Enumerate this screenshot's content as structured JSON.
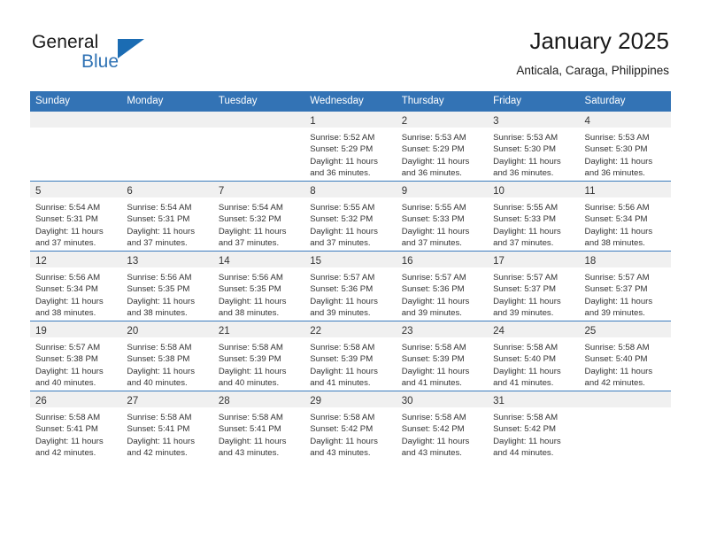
{
  "brand": {
    "name_part1": "General",
    "name_part2": "Blue",
    "accent_color": "#2f72b4"
  },
  "header": {
    "title": "January 2025",
    "subtitle": "Anticala, Caraga, Philippines"
  },
  "calendar": {
    "header_color": "#3373b5",
    "weekday_headers": [
      "Sunday",
      "Monday",
      "Tuesday",
      "Wednesday",
      "Thursday",
      "Friday",
      "Saturday"
    ],
    "weeks": [
      [
        {
          "day": "",
          "sunrise": "",
          "sunset": "",
          "daylight_1": "",
          "daylight_2": ""
        },
        {
          "day": "",
          "sunrise": "",
          "sunset": "",
          "daylight_1": "",
          "daylight_2": ""
        },
        {
          "day": "",
          "sunrise": "",
          "sunset": "",
          "daylight_1": "",
          "daylight_2": ""
        },
        {
          "day": "1",
          "sunrise": "Sunrise: 5:52 AM",
          "sunset": "Sunset: 5:29 PM",
          "daylight_1": "Daylight: 11 hours",
          "daylight_2": "and 36 minutes."
        },
        {
          "day": "2",
          "sunrise": "Sunrise: 5:53 AM",
          "sunset": "Sunset: 5:29 PM",
          "daylight_1": "Daylight: 11 hours",
          "daylight_2": "and 36 minutes."
        },
        {
          "day": "3",
          "sunrise": "Sunrise: 5:53 AM",
          "sunset": "Sunset: 5:30 PM",
          "daylight_1": "Daylight: 11 hours",
          "daylight_2": "and 36 minutes."
        },
        {
          "day": "4",
          "sunrise": "Sunrise: 5:53 AM",
          "sunset": "Sunset: 5:30 PM",
          "daylight_1": "Daylight: 11 hours",
          "daylight_2": "and 36 minutes."
        }
      ],
      [
        {
          "day": "5",
          "sunrise": "Sunrise: 5:54 AM",
          "sunset": "Sunset: 5:31 PM",
          "daylight_1": "Daylight: 11 hours",
          "daylight_2": "and 37 minutes."
        },
        {
          "day": "6",
          "sunrise": "Sunrise: 5:54 AM",
          "sunset": "Sunset: 5:31 PM",
          "daylight_1": "Daylight: 11 hours",
          "daylight_2": "and 37 minutes."
        },
        {
          "day": "7",
          "sunrise": "Sunrise: 5:54 AM",
          "sunset": "Sunset: 5:32 PM",
          "daylight_1": "Daylight: 11 hours",
          "daylight_2": "and 37 minutes."
        },
        {
          "day": "8",
          "sunrise": "Sunrise: 5:55 AM",
          "sunset": "Sunset: 5:32 PM",
          "daylight_1": "Daylight: 11 hours",
          "daylight_2": "and 37 minutes."
        },
        {
          "day": "9",
          "sunrise": "Sunrise: 5:55 AM",
          "sunset": "Sunset: 5:33 PM",
          "daylight_1": "Daylight: 11 hours",
          "daylight_2": "and 37 minutes."
        },
        {
          "day": "10",
          "sunrise": "Sunrise: 5:55 AM",
          "sunset": "Sunset: 5:33 PM",
          "daylight_1": "Daylight: 11 hours",
          "daylight_2": "and 37 minutes."
        },
        {
          "day": "11",
          "sunrise": "Sunrise: 5:56 AM",
          "sunset": "Sunset: 5:34 PM",
          "daylight_1": "Daylight: 11 hours",
          "daylight_2": "and 38 minutes."
        }
      ],
      [
        {
          "day": "12",
          "sunrise": "Sunrise: 5:56 AM",
          "sunset": "Sunset: 5:34 PM",
          "daylight_1": "Daylight: 11 hours",
          "daylight_2": "and 38 minutes."
        },
        {
          "day": "13",
          "sunrise": "Sunrise: 5:56 AM",
          "sunset": "Sunset: 5:35 PM",
          "daylight_1": "Daylight: 11 hours",
          "daylight_2": "and 38 minutes."
        },
        {
          "day": "14",
          "sunrise": "Sunrise: 5:56 AM",
          "sunset": "Sunset: 5:35 PM",
          "daylight_1": "Daylight: 11 hours",
          "daylight_2": "and 38 minutes."
        },
        {
          "day": "15",
          "sunrise": "Sunrise: 5:57 AM",
          "sunset": "Sunset: 5:36 PM",
          "daylight_1": "Daylight: 11 hours",
          "daylight_2": "and 39 minutes."
        },
        {
          "day": "16",
          "sunrise": "Sunrise: 5:57 AM",
          "sunset": "Sunset: 5:36 PM",
          "daylight_1": "Daylight: 11 hours",
          "daylight_2": "and 39 minutes."
        },
        {
          "day": "17",
          "sunrise": "Sunrise: 5:57 AM",
          "sunset": "Sunset: 5:37 PM",
          "daylight_1": "Daylight: 11 hours",
          "daylight_2": "and 39 minutes."
        },
        {
          "day": "18",
          "sunrise": "Sunrise: 5:57 AM",
          "sunset": "Sunset: 5:37 PM",
          "daylight_1": "Daylight: 11 hours",
          "daylight_2": "and 39 minutes."
        }
      ],
      [
        {
          "day": "19",
          "sunrise": "Sunrise: 5:57 AM",
          "sunset": "Sunset: 5:38 PM",
          "daylight_1": "Daylight: 11 hours",
          "daylight_2": "and 40 minutes."
        },
        {
          "day": "20",
          "sunrise": "Sunrise: 5:58 AM",
          "sunset": "Sunset: 5:38 PM",
          "daylight_1": "Daylight: 11 hours",
          "daylight_2": "and 40 minutes."
        },
        {
          "day": "21",
          "sunrise": "Sunrise: 5:58 AM",
          "sunset": "Sunset: 5:39 PM",
          "daylight_1": "Daylight: 11 hours",
          "daylight_2": "and 40 minutes."
        },
        {
          "day": "22",
          "sunrise": "Sunrise: 5:58 AM",
          "sunset": "Sunset: 5:39 PM",
          "daylight_1": "Daylight: 11 hours",
          "daylight_2": "and 41 minutes."
        },
        {
          "day": "23",
          "sunrise": "Sunrise: 5:58 AM",
          "sunset": "Sunset: 5:39 PM",
          "daylight_1": "Daylight: 11 hours",
          "daylight_2": "and 41 minutes."
        },
        {
          "day": "24",
          "sunrise": "Sunrise: 5:58 AM",
          "sunset": "Sunset: 5:40 PM",
          "daylight_1": "Daylight: 11 hours",
          "daylight_2": "and 41 minutes."
        },
        {
          "day": "25",
          "sunrise": "Sunrise: 5:58 AM",
          "sunset": "Sunset: 5:40 PM",
          "daylight_1": "Daylight: 11 hours",
          "daylight_2": "and 42 minutes."
        }
      ],
      [
        {
          "day": "26",
          "sunrise": "Sunrise: 5:58 AM",
          "sunset": "Sunset: 5:41 PM",
          "daylight_1": "Daylight: 11 hours",
          "daylight_2": "and 42 minutes."
        },
        {
          "day": "27",
          "sunrise": "Sunrise: 5:58 AM",
          "sunset": "Sunset: 5:41 PM",
          "daylight_1": "Daylight: 11 hours",
          "daylight_2": "and 42 minutes."
        },
        {
          "day": "28",
          "sunrise": "Sunrise: 5:58 AM",
          "sunset": "Sunset: 5:41 PM",
          "daylight_1": "Daylight: 11 hours",
          "daylight_2": "and 43 minutes."
        },
        {
          "day": "29",
          "sunrise": "Sunrise: 5:58 AM",
          "sunset": "Sunset: 5:42 PM",
          "daylight_1": "Daylight: 11 hours",
          "daylight_2": "and 43 minutes."
        },
        {
          "day": "30",
          "sunrise": "Sunrise: 5:58 AM",
          "sunset": "Sunset: 5:42 PM",
          "daylight_1": "Daylight: 11 hours",
          "daylight_2": "and 43 minutes."
        },
        {
          "day": "31",
          "sunrise": "Sunrise: 5:58 AM",
          "sunset": "Sunset: 5:42 PM",
          "daylight_1": "Daylight: 11 hours",
          "daylight_2": "and 44 minutes."
        },
        {
          "day": "",
          "sunrise": "",
          "sunset": "",
          "daylight_1": "",
          "daylight_2": ""
        }
      ]
    ]
  }
}
